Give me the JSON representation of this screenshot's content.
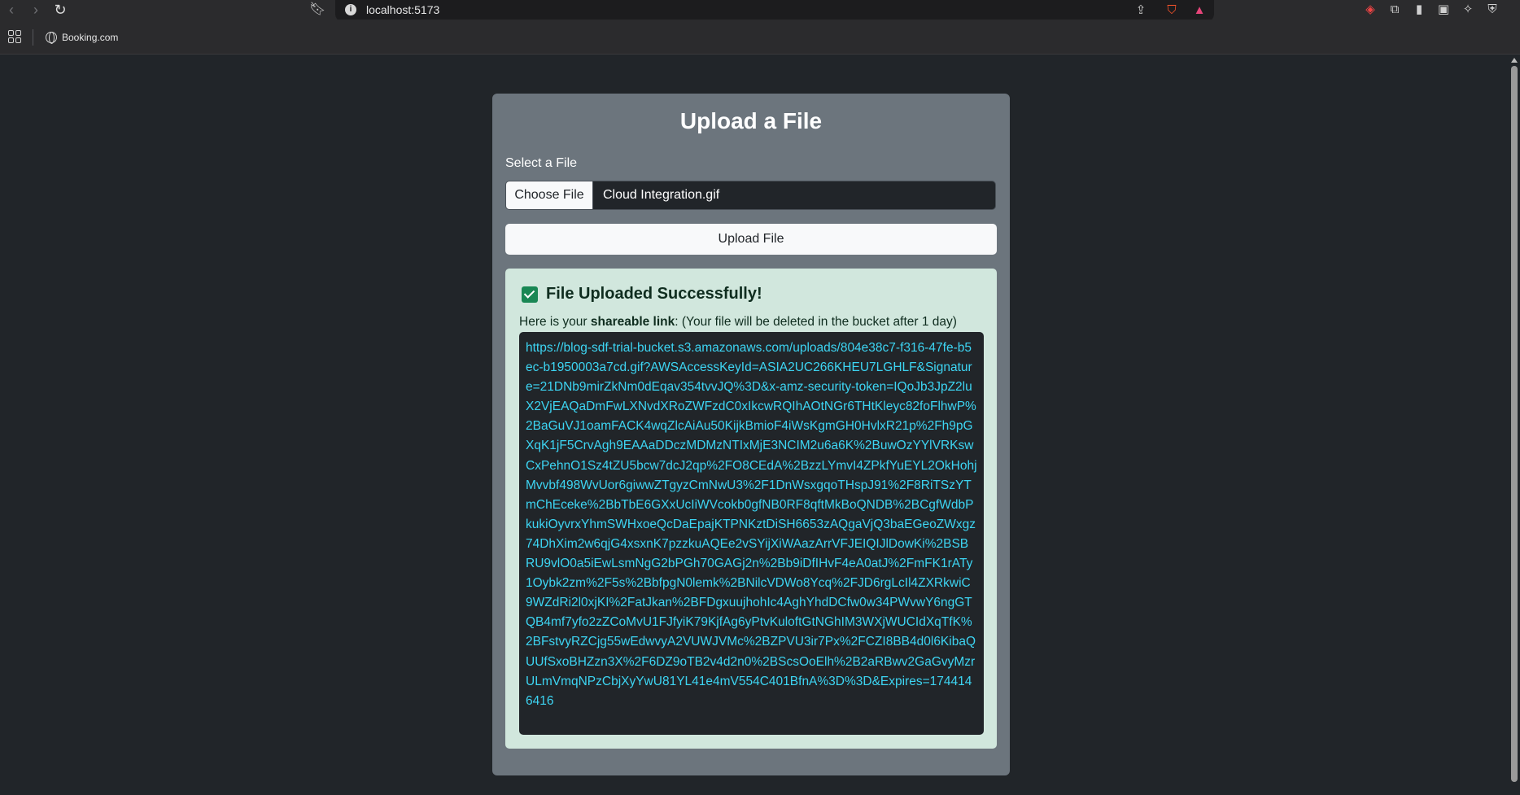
{
  "browser": {
    "url": "localhost:5173",
    "bookmarks": [
      {
        "label": "Booking.com"
      }
    ]
  },
  "page": {
    "title": "Upload a File",
    "file_label": "Select a File",
    "choose_button": "Choose File",
    "selected_file": "Cloud Integration.gif",
    "upload_button": "Upload File",
    "alert": {
      "title": "File Uploaded Successfully!",
      "text_prefix": "Here is your ",
      "text_bold": "shareable link",
      "text_suffix": ": (Your file will be deleted in the bucket after 1 day)",
      "link": "https://blog-sdf-trial-bucket.s3.amazonaws.com/uploads/804e38c7-f316-47fe-b5ec-b1950003a7cd.gif?AWSAccessKeyId=ASIA2UC266KHEU7LGHLF&Signature=21DNb9mirZkNm0dEqav354tvvJQ%3D&x-amz-security-token=IQoJb3JpZ2luX2VjEAQaDmFwLXNvdXRoZWFzdC0xIkcwRQIhAOtNGr6THtKleyc82foFlhwP%2BaGuVJ1oamFACK4wqZlcAiAu50KijkBmioF4iWsKgmGH0HvlxR21p%2Fh9pGXqK1jF5CrvAgh9EAAaDDczMDMzNTIxMjE3NCIM2u6a6K%2BuwOzYYlVRKswCxPehnO1Sz4tZU5bcw7dcJ2qp%2FO8CEdA%2BzzLYmvI4ZPkfYuEYL2OkHohjMvvbf498WvUor6giwwZTgyzCmNwU3%2F1DnWsxgqoTHspJ91%2F8RiTSzYTmChEceke%2BbTbE6GXxUcIiWVcokb0gfNB0RF8qftMkBoQNDB%2BCgfWdbPkukiOyvrxYhmSWHxoeQcDaEpajKTPNKztDiSH6653zAQgaVjQ3baEGeoZWxgz74DhXim2w6qjG4xsxnK7pzzkuAQEe2vSYijXiWAazArrVFJEIQIJlDowKi%2BSBRU9vlO0a5iEwLsmNgG2bPGh70GAGj2n%2Bb9iDfIHvF4eA0atJ%2FmFK1rATy1Oybk2zm%2F5s%2BbfpgN0lemk%2BNilcVDWo8Ycq%2FJD6rgLcIl4ZXRkwiC9WZdRi2l0xjKI%2FatJkan%2BFDgxuujhohIc4AghYhdDCfw0w34PWvwY6ngGTQB4mf7yfo2zZCoMvU1FJfyiK79KjfAg6yPtvKuloftGtNGhIM3WXjWUCIdXqTfK%2BFstvyRZCjg55wEdwvyA2VUWJVMc%2BZPVU3ir7Px%2FCZI8BB4d0l6KibaQUUfSxoBHZzn3X%2F6DZ9oTB2v4d2n0%2BScsOoElh%2B2aRBwv2GaGvyMzrULmVmqNPzCbjXyYwU81YL41e4mV554C401BfnA%3D%3D&Expires=1744146416"
    }
  }
}
